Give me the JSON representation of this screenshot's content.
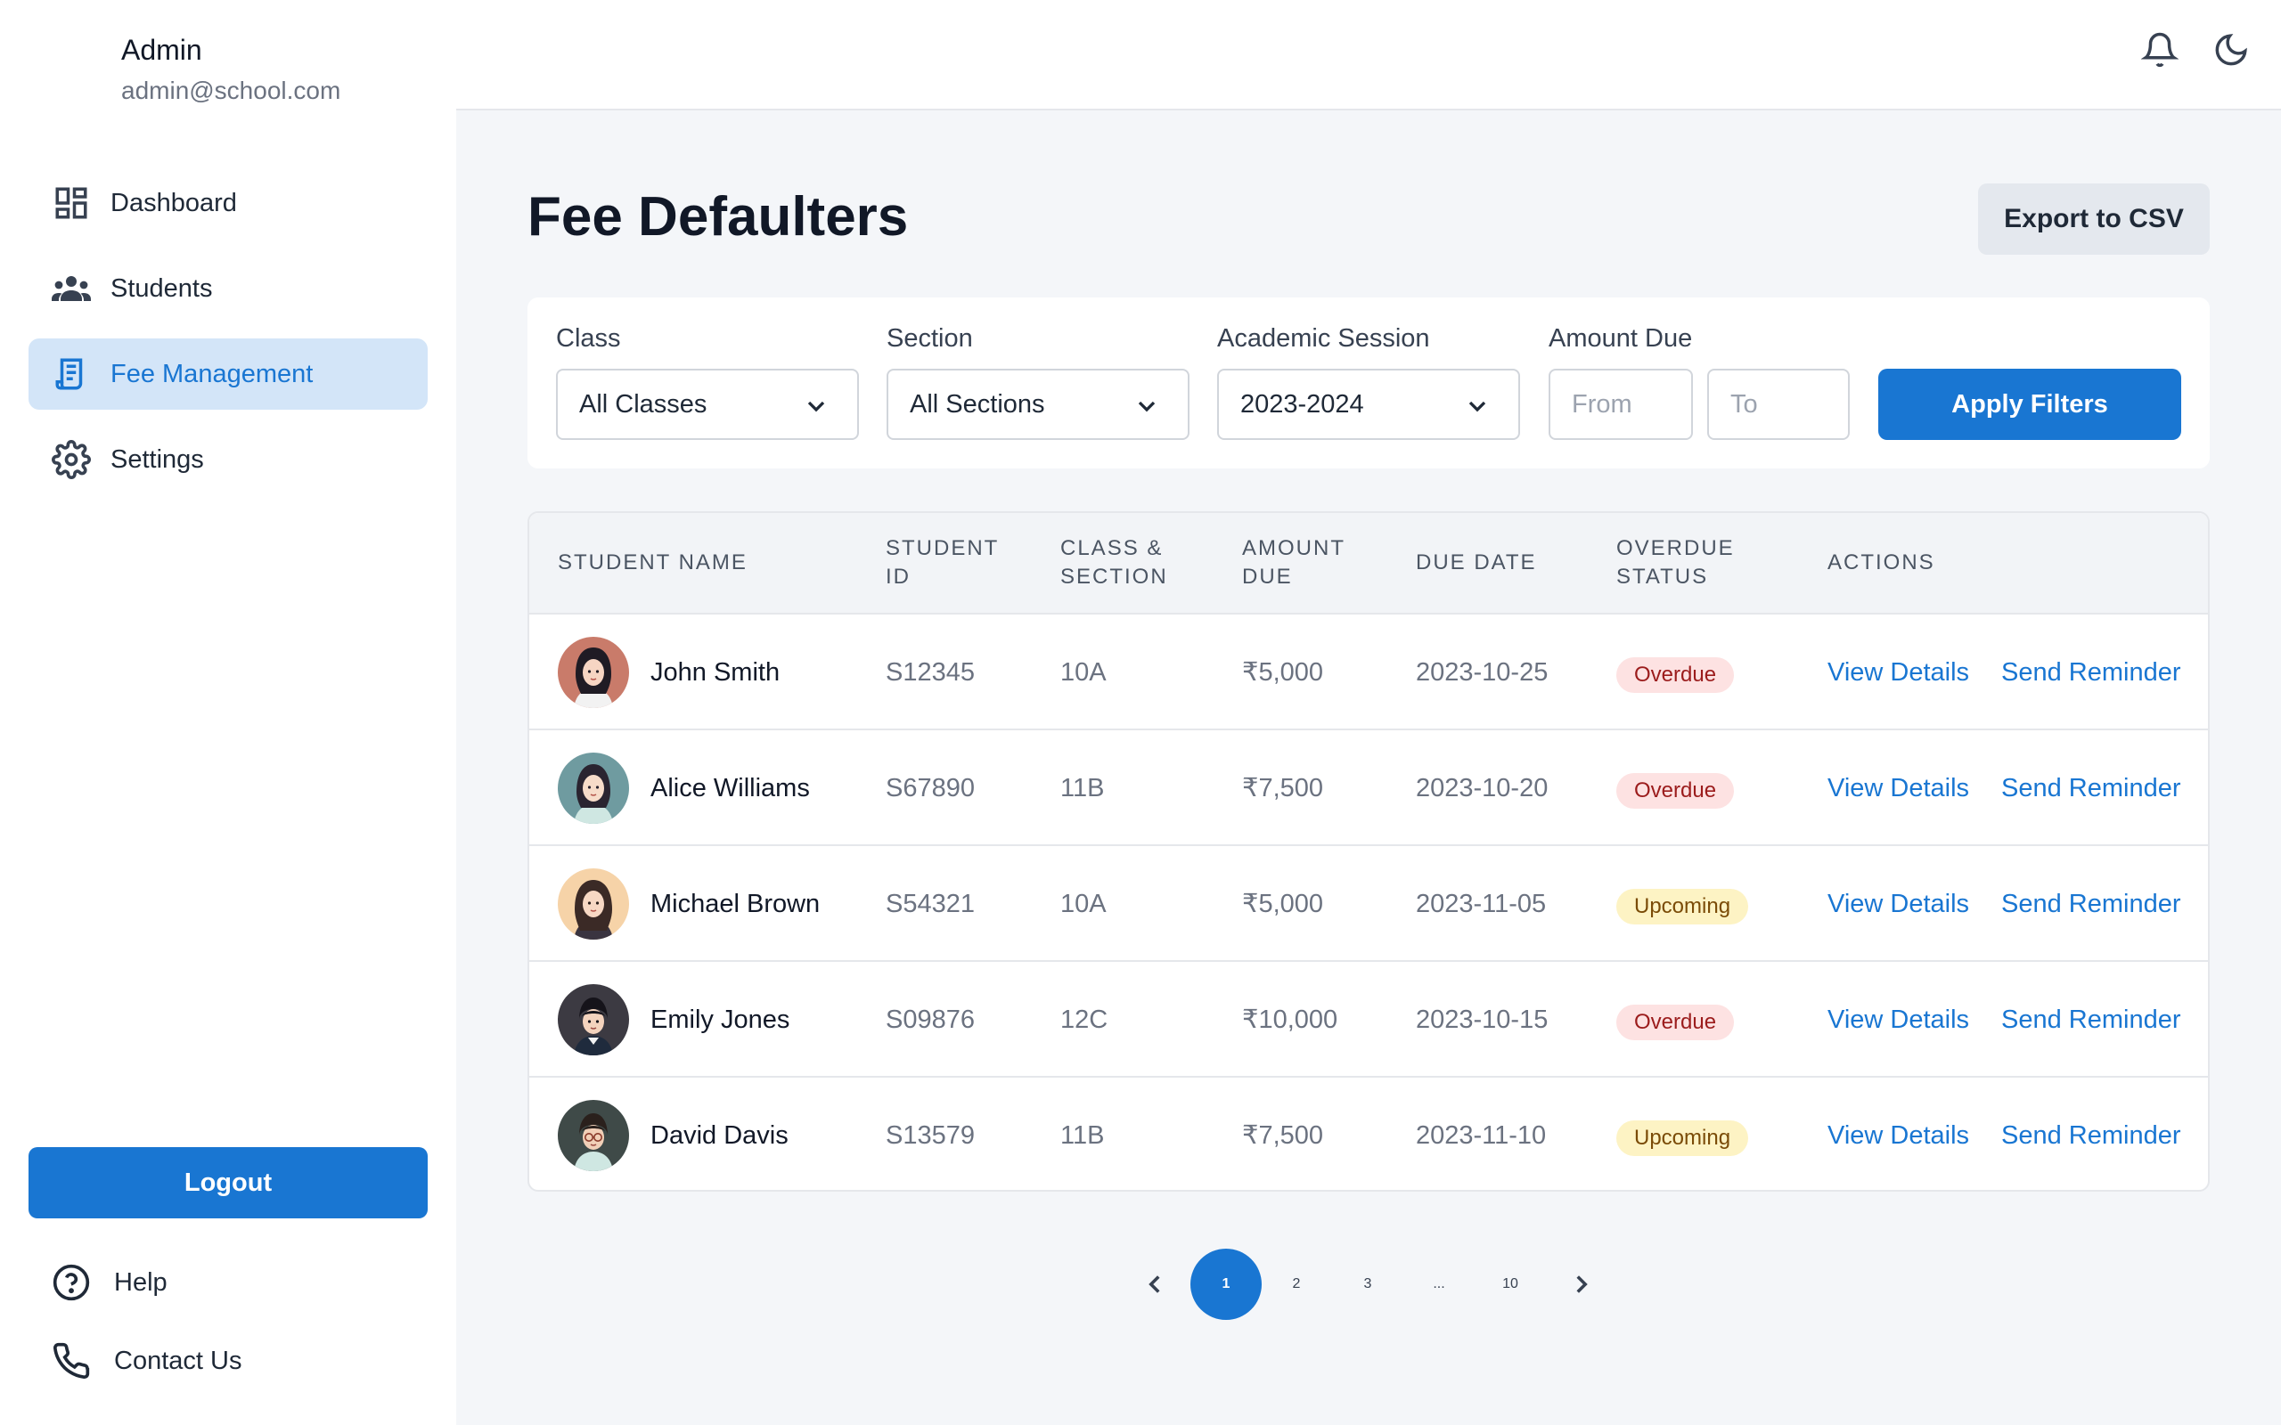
{
  "user": {
    "name": "Admin",
    "email": "admin@school.com"
  },
  "sidebar": {
    "items": [
      {
        "label": "Dashboard",
        "icon": "dashboard-icon",
        "active": false
      },
      {
        "label": "Students",
        "icon": "users-icon",
        "active": false
      },
      {
        "label": "Fee Management",
        "icon": "receipt-icon",
        "active": true
      },
      {
        "label": "Settings",
        "icon": "gear-icon",
        "active": false
      }
    ],
    "logout_label": "Logout",
    "bottom_links": [
      {
        "label": "Help",
        "icon": "help-icon"
      },
      {
        "label": "Contact Us",
        "icon": "phone-icon"
      }
    ]
  },
  "topbar": {
    "icons": [
      "bell-icon",
      "moon-icon"
    ]
  },
  "page": {
    "title": "Fee Defaulters",
    "export_label": "Export to CSV"
  },
  "filters": {
    "class_label": "Class",
    "class_value": "All Classes",
    "section_label": "Section",
    "section_value": "All Sections",
    "session_label": "Academic Session",
    "session_value": "2023-2024",
    "amount_label": "Amount Due",
    "from_placeholder": "From",
    "to_placeholder": "To",
    "apply_label": "Apply Filters"
  },
  "table": {
    "headers": {
      "student_name": "STUDENT NAME",
      "student_id_1": "STUDENT",
      "student_id_2": "ID",
      "class_1": "CLASS &",
      "class_2": "SECTION",
      "amount_1": "AMOUNT",
      "amount_2": "DUE",
      "due_date": "DUE DATE",
      "status_1": "OVERDUE",
      "status_2": "STATUS",
      "actions": "ACTIONS"
    },
    "rows": [
      {
        "name": "John Smith",
        "id": "S12345",
        "class": "10A",
        "amount": "₹5,000",
        "due": "2023-10-25",
        "status": "Overdue"
      },
      {
        "name": "Alice Williams",
        "id": "S67890",
        "class": "11B",
        "amount": "₹7,500",
        "due": "2023-10-20",
        "status": "Overdue"
      },
      {
        "name": "Michael Brown",
        "id": "S54321",
        "class": "10A",
        "amount": "₹5,000",
        "due": "2023-11-05",
        "status": "Upcoming"
      },
      {
        "name": "Emily Jones",
        "id": "S09876",
        "class": "12C",
        "amount": "₹10,000",
        "due": "2023-10-15",
        "status": "Overdue"
      },
      {
        "name": "David Davis",
        "id": "S13579",
        "class": "11B",
        "amount": "₹7,500",
        "due": "2023-11-10",
        "status": "Upcoming"
      }
    ],
    "view_label": "View Details",
    "remind_label": "Send Reminder"
  },
  "pagination": {
    "pages": [
      "1",
      "2",
      "3",
      "...",
      "10"
    ],
    "current": "1"
  },
  "colors": {
    "accent": "#1976d2",
    "active_nav_bg": "#d3e5f8",
    "overdue_bg": "#fde2e2",
    "overdue_text": "#9b1c1c",
    "upcoming_bg": "#fdf3c4",
    "upcoming_text": "#7a4b07"
  }
}
